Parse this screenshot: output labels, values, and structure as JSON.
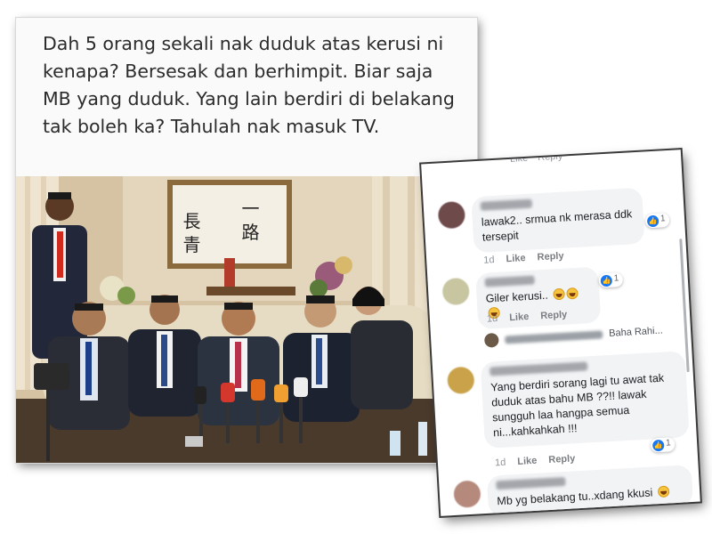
{
  "post": {
    "text": "Dah 5 orang sekali nak duduk atas kerusi ni kenapa? Bersesak dan berhimpit. Biar saja MB yang duduk. Yang lain berdiri di belakang tak boleh ka? Tahulah nak masuk TV.",
    "calligraphy_left": "長 青",
    "calligraphy_right": "一 路"
  },
  "comments_panel": {
    "top_actions": [
      "Like",
      "Reply"
    ],
    "comments": [
      {
        "text": "lawak2.. srmua nk merasa ddk tersepit",
        "time": "1d",
        "like": "Like",
        "reply": "Reply",
        "reaction_count": "1",
        "avatar_color": "#6e4a4a"
      },
      {
        "text": "Giler kerusi..",
        "time": "1d",
        "like": "Like",
        "reply": "Reply",
        "reaction_count": "1",
        "avatar_color": "#c8c6a0"
      },
      {
        "text": "Yang berdiri sorang lagi tu awat tak duduk atas bahu MB ??!! lawak sungguh laa hangpa semua ni...kahkahkah !!!",
        "time": "1d",
        "like": "Like",
        "reply": "Reply",
        "reaction_count": "1",
        "avatar_color": "#c9a24a"
      },
      {
        "text": "Mb yg belakang tu..xdang kkusi",
        "time": "",
        "like": "",
        "reply": "",
        "reaction_count": "",
        "avatar_color": "#b58a7c"
      }
    ],
    "reply_preview": {
      "author_suffix": "Baha Rahi..."
    }
  }
}
